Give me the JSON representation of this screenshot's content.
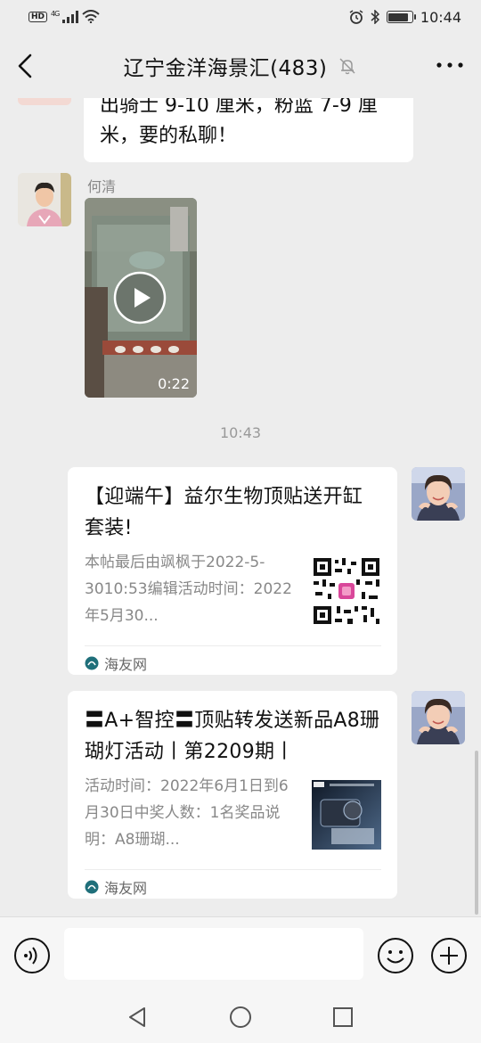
{
  "status_bar": {
    "hd": "HD",
    "network": "4G",
    "time": "10:44",
    "battery_level": 0.85,
    "icons": [
      "hd-icon",
      "signal-icon",
      "wifi-icon",
      "alarm-icon",
      "bluetooth-icon",
      "battery-icon"
    ]
  },
  "header": {
    "title": "辽宁金洋海景汇(483)",
    "back_icon": "back-arrow-icon",
    "mute_icon": "mute-bell-icon",
    "more_icon": "more-dots-icon"
  },
  "messages": [
    {
      "type": "text",
      "partial": true,
      "lines": [
        "出骑士 9-10 厘米，粉蓝 7-9 厘",
        "米，要的私聊！"
      ]
    },
    {
      "type": "video",
      "sender": "何清",
      "duration": "0:22"
    },
    {
      "type": "time",
      "text": "10:43"
    },
    {
      "type": "link-card",
      "title": "【迎端午】益尔生物顶贴送开缸套装!",
      "description": "本帖最后由飒枫于2022-5-3010:53编辑活动时间：2022年5月30...",
      "source": "海友网",
      "thumbnail": "qr-code-thumbnail"
    },
    {
      "type": "link-card",
      "title": "〓A+智控〓顶贴转发送新品A8珊 瑚灯活动丨第2209期丨",
      "description": "活动时间：2022年6月1日到6月30日中奖人数：1名奖品说明：A8珊瑚...",
      "source": "海友网",
      "thumbnail": "product-thumbnail"
    }
  ],
  "input_bar": {
    "value": "",
    "icons": [
      "voice-icon",
      "emoji-icon",
      "plus-icon"
    ]
  },
  "system_nav": {
    "icons": [
      "back-triangle-icon",
      "home-circle-icon",
      "recents-square-icon"
    ]
  },
  "colors": {
    "background": "#ededed",
    "bubble": "#ffffff",
    "secondary_text": "#888888",
    "input_bar": "#f6f6f6"
  }
}
